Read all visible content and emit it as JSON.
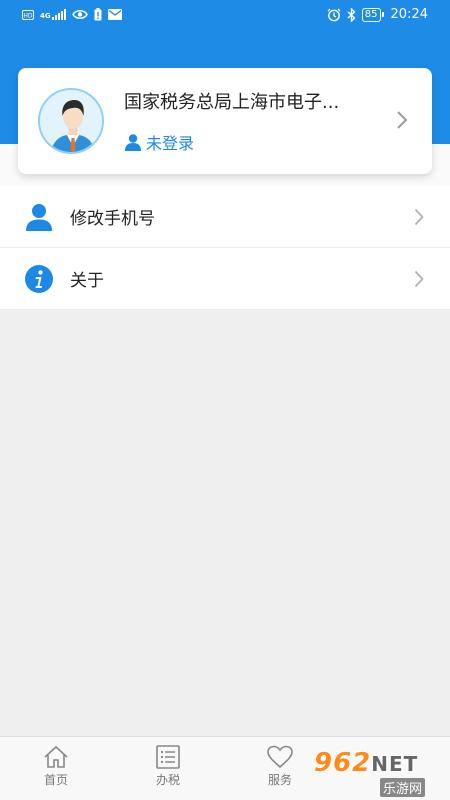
{
  "status_bar": {
    "left_icons": [
      "hd-icon",
      "signal-4g-icon",
      "eye-icon",
      "battery-alert-icon",
      "mail-icon"
    ],
    "network_label": "4G",
    "right_icons": [
      "alarm-icon",
      "bluetooth-icon"
    ],
    "battery_level": "85",
    "time": "20:24"
  },
  "profile": {
    "org_name": "国家税务总局上海市电子...",
    "login_status": "未登录",
    "accent_color": "#1e88e5"
  },
  "menu": {
    "items": [
      {
        "label": "修改手机号",
        "icon": "user-icon"
      },
      {
        "label": "关于",
        "icon": "info-icon"
      }
    ]
  },
  "tabbar": {
    "tabs": [
      {
        "label": "首页",
        "icon": "home-icon"
      },
      {
        "label": "办税",
        "icon": "list-icon"
      },
      {
        "label": "服务",
        "icon": "heart-icon"
      }
    ]
  },
  "watermark": {
    "brand": "962",
    "suffix": "NET",
    "site": "乐游网"
  },
  "colors": {
    "header_blue": "#1e8ce6",
    "background": "#efefef"
  }
}
